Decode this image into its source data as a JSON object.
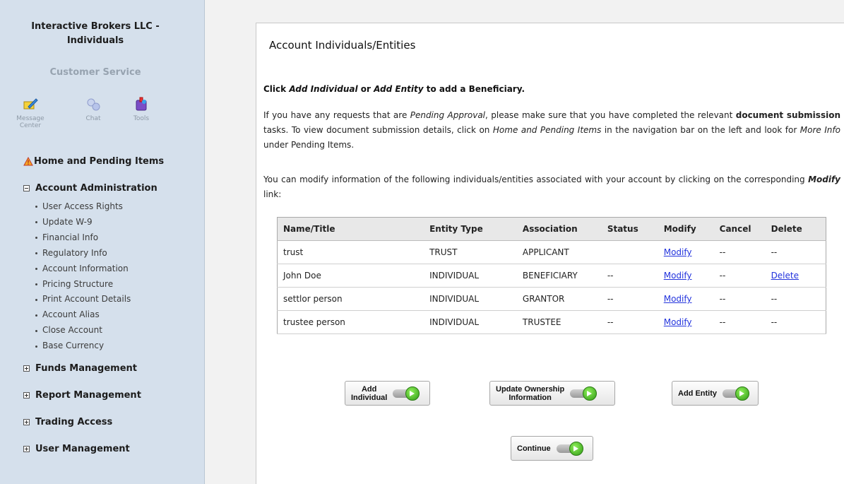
{
  "sidebar": {
    "title_line1": "Interactive Brokers LLC -",
    "title_line2": "Individuals",
    "customer_service": "Customer Service",
    "tools": [
      {
        "label_line1": "Message",
        "label_line2": "Center",
        "icon": "message-center-icon"
      },
      {
        "label_line1": "Chat",
        "label_line2": "",
        "icon": "chat-icon"
      },
      {
        "label_line1": "Tools",
        "label_line2": "",
        "icon": "tools-icon"
      }
    ],
    "home": "Home and Pending Items",
    "account_admin": "Account Administration",
    "account_admin_items": [
      "User Access Rights",
      "Update W-9",
      "Financial Info",
      "Regulatory Info",
      "Account Information",
      "Pricing Structure",
      "Print Account Details",
      "Account Alias",
      "Close Account",
      "Base Currency"
    ],
    "sections": [
      "Funds Management",
      "Report Management",
      "Trading Access",
      "User Management"
    ]
  },
  "main": {
    "heading": "Account Individuals/Entities",
    "instruction_prefix": "Click ",
    "instruction_add_individual": "Add Individual",
    "instruction_or": " or ",
    "instruction_add_entity": "Add Entity",
    "instruction_suffix": " to add a Beneficiary.",
    "p2_a": "If you have any requests that are ",
    "p2_pending": "Pending Approval",
    "p2_b": ", please make sure that you have completed the relevant ",
    "p2_docsub": "document submission",
    "p2_c": " tasks. To view document submission details, click on ",
    "p2_home": "Home and Pending Items",
    "p2_d": " in the navigation bar on the left and look for ",
    "p2_moreinfo": "More Info",
    "p2_e": " under Pending Items.",
    "p3_a": "You can modify information of the following individuals/entities associated with your account by clicking on the corresponding ",
    "p3_modify": "Modify",
    "p3_b": " link:"
  },
  "table": {
    "headers": [
      "Name/Title",
      "Entity Type",
      "Association",
      "Status",
      "Modify",
      "Cancel",
      "Delete"
    ],
    "rows": [
      {
        "name": "trust",
        "type": "TRUST",
        "association": "APPLICANT",
        "status": "",
        "modify": "Modify",
        "cancel": "--",
        "delete": "--"
      },
      {
        "name": "John Doe",
        "type": "INDIVIDUAL",
        "association": "BENEFICIARY",
        "status": "--",
        "modify": "Modify",
        "cancel": "--",
        "delete": "Delete"
      },
      {
        "name": "settlor person",
        "type": "INDIVIDUAL",
        "association": "GRANTOR",
        "status": "--",
        "modify": "Modify",
        "cancel": "--",
        "delete": "--"
      },
      {
        "name": "trustee person",
        "type": "INDIVIDUAL",
        "association": "TRUSTEE",
        "status": "--",
        "modify": "Modify",
        "cancel": "--",
        "delete": "--"
      }
    ]
  },
  "buttons": {
    "add_individual_line1": "Add",
    "add_individual_line2": "Individual",
    "update_ownership_line1": "Update Ownership",
    "update_ownership_line2": "Information",
    "add_entity": "Add Entity",
    "continue": "Continue"
  },
  "colors": {
    "sidebar_bg": "#d5e0ec",
    "link": "#2233dd",
    "go_green": "#3aa51a"
  }
}
